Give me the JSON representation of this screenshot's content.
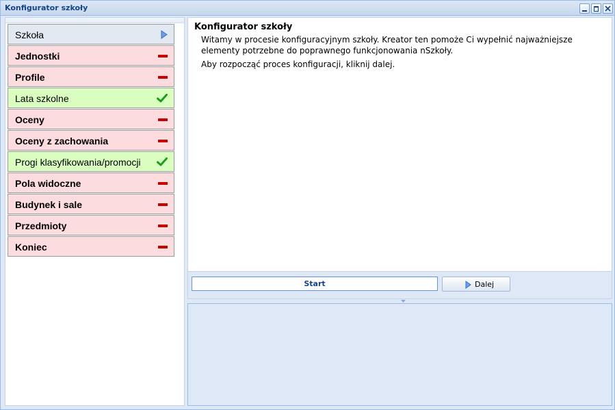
{
  "window": {
    "title": "Konfigurator szkoły"
  },
  "steps": [
    {
      "label": "Szkoła",
      "state": "current",
      "icon": "arrow-right-icon"
    },
    {
      "label": "Jednostki",
      "state": "pending",
      "icon": "minus-icon"
    },
    {
      "label": "Profile",
      "state": "pending",
      "icon": "minus-icon"
    },
    {
      "label": "Lata szkolne",
      "state": "done",
      "icon": "checkmark-icon"
    },
    {
      "label": "Oceny",
      "state": "pending",
      "icon": "minus-icon"
    },
    {
      "label": "Oceny z zachowania",
      "state": "pending",
      "icon": "minus-icon"
    },
    {
      "label": "Progi klasyfikowania/promocji",
      "state": "done",
      "icon": "checkmark-icon"
    },
    {
      "label": "Pola widoczne",
      "state": "pending",
      "icon": "minus-icon"
    },
    {
      "label": "Budynek i sale",
      "state": "pending",
      "icon": "minus-icon"
    },
    {
      "label": "Przedmioty",
      "state": "pending",
      "icon": "minus-icon"
    },
    {
      "label": "Koniec",
      "state": "pending",
      "icon": "minus-icon"
    }
  ],
  "content": {
    "title": "Konfigurator szkoły",
    "paragraph1": "Witamy w procesie konfiguracyjnym szkoły. Kreator ten pomoże Ci wypełnić najważniejsze elementy potrzebne do poprawnego funkcjonowania nSzkoły.",
    "paragraph2": "Aby rozpocząć proces konfiguracji, kliknij dalej."
  },
  "toolbar": {
    "progress_label": "Start",
    "progress_fraction": 0,
    "next_label": "Dalej"
  },
  "colors": {
    "pending": "#fddcdf",
    "done": "#dafdc0",
    "current": "#e3e9f3",
    "minus": "#c80000",
    "check": "#1a9e1a",
    "accent": "#15428b"
  }
}
